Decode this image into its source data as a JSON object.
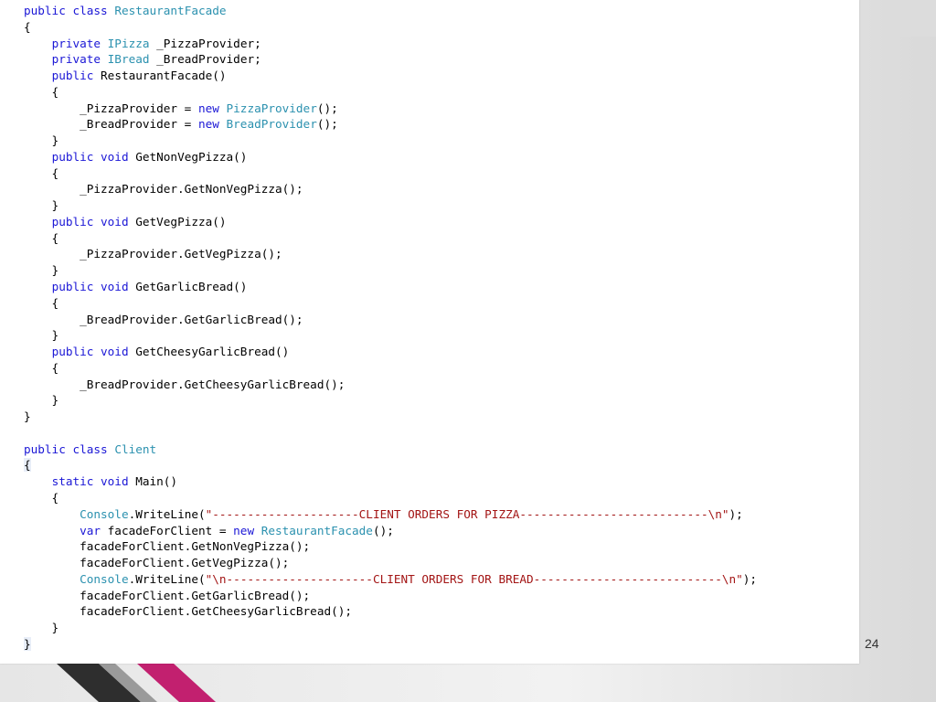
{
  "slide": {
    "page_number": "24",
    "colors": {
      "keyword": "#1b17d6",
      "type": "#2b91af",
      "string": "#a31515",
      "accent_magenta": "#c2206f",
      "accent_dark": "#2e2e2e"
    }
  },
  "code": {
    "lines": [
      [
        {
          "t": "public class ",
          "c": "kw"
        },
        {
          "t": "RestaurantFacade",
          "c": "type"
        }
      ],
      [
        {
          "t": "{"
        }
      ],
      [
        {
          "t": "    "
        },
        {
          "t": "private ",
          "c": "kw"
        },
        {
          "t": "IPizza",
          "c": "type"
        },
        {
          "t": " _PizzaProvider;"
        }
      ],
      [
        {
          "t": "    "
        },
        {
          "t": "private ",
          "c": "kw"
        },
        {
          "t": "IBread",
          "c": "type"
        },
        {
          "t": " _BreadProvider;"
        }
      ],
      [
        {
          "t": "    "
        },
        {
          "t": "public ",
          "c": "kw"
        },
        {
          "t": "RestaurantFacade()"
        }
      ],
      [
        {
          "t": "    {"
        }
      ],
      [
        {
          "t": "        _PizzaProvider = "
        },
        {
          "t": "new ",
          "c": "kw"
        },
        {
          "t": "PizzaProvider",
          "c": "type"
        },
        {
          "t": "();"
        }
      ],
      [
        {
          "t": "        _BreadProvider = "
        },
        {
          "t": "new ",
          "c": "kw"
        },
        {
          "t": "BreadProvider",
          "c": "type"
        },
        {
          "t": "();"
        }
      ],
      [
        {
          "t": "    }"
        }
      ],
      [
        {
          "t": "    "
        },
        {
          "t": "public void ",
          "c": "kw"
        },
        {
          "t": "GetNonVegPizza()"
        }
      ],
      [
        {
          "t": "    {"
        }
      ],
      [
        {
          "t": "        _PizzaProvider.GetNonVegPizza();"
        }
      ],
      [
        {
          "t": "    }"
        }
      ],
      [
        {
          "t": "    "
        },
        {
          "t": "public void ",
          "c": "kw"
        },
        {
          "t": "GetVegPizza()"
        }
      ],
      [
        {
          "t": "    {"
        }
      ],
      [
        {
          "t": "        _PizzaProvider.GetVegPizza();"
        }
      ],
      [
        {
          "t": "    }"
        }
      ],
      [
        {
          "t": "    "
        },
        {
          "t": "public void ",
          "c": "kw"
        },
        {
          "t": "GetGarlicBread()"
        }
      ],
      [
        {
          "t": "    {"
        }
      ],
      [
        {
          "t": "        _BreadProvider.GetGarlicBread();"
        }
      ],
      [
        {
          "t": "    }"
        }
      ],
      [
        {
          "t": "    "
        },
        {
          "t": "public void ",
          "c": "kw"
        },
        {
          "t": "GetCheesyGarlicBread()"
        }
      ],
      [
        {
          "t": "    {"
        }
      ],
      [
        {
          "t": "        _BreadProvider.GetCheesyGarlicBread();"
        }
      ],
      [
        {
          "t": "    }"
        }
      ],
      [
        {
          "t": "}"
        }
      ],
      [
        {
          "t": ""
        }
      ],
      [
        {
          "t": "public class ",
          "c": "kw"
        },
        {
          "t": "Client",
          "c": "type"
        }
      ],
      [
        {
          "t": "{",
          "c": "hl-brace"
        }
      ],
      [
        {
          "t": "    "
        },
        {
          "t": "static void ",
          "c": "kw"
        },
        {
          "t": "Main()"
        }
      ],
      [
        {
          "t": "    {"
        }
      ],
      [
        {
          "t": "        "
        },
        {
          "t": "Console",
          "c": "type"
        },
        {
          "t": ".WriteLine("
        },
        {
          "t": "\"---------------------CLIENT ORDERS FOR PIZZA---------------------------\\n\"",
          "c": "str"
        },
        {
          "t": ");"
        }
      ],
      [
        {
          "t": "        "
        },
        {
          "t": "var ",
          "c": "kw"
        },
        {
          "t": "facadeForClient = "
        },
        {
          "t": "new ",
          "c": "kw"
        },
        {
          "t": "RestaurantFacade",
          "c": "type"
        },
        {
          "t": "();"
        }
      ],
      [
        {
          "t": "        facadeForClient.GetNonVegPizza();"
        }
      ],
      [
        {
          "t": "        facadeForClient.GetVegPizza();"
        }
      ],
      [
        {
          "t": "        "
        },
        {
          "t": "Console",
          "c": "type"
        },
        {
          "t": ".WriteLine("
        },
        {
          "t": "\"\\n---------------------CLIENT ORDERS FOR BREAD---------------------------\\n\"",
          "c": "str"
        },
        {
          "t": ");"
        }
      ],
      [
        {
          "t": "        facadeForClient.GetGarlicBread();"
        }
      ],
      [
        {
          "t": "        facadeForClient.GetCheesyGarlicBread();"
        }
      ],
      [
        {
          "t": "    }"
        }
      ],
      [
        {
          "t": "}",
          "c": "hl-brace"
        }
      ]
    ]
  }
}
